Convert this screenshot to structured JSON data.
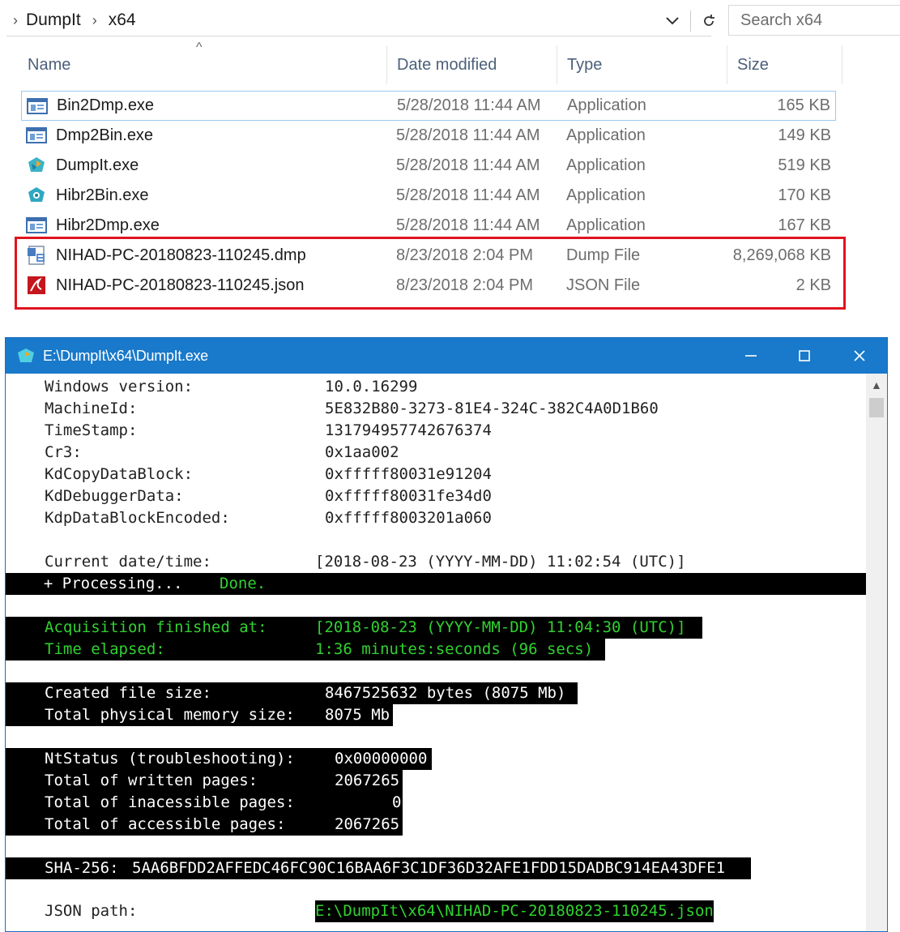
{
  "explorer": {
    "breadcrumb": [
      "DumpIt",
      "x64"
    ],
    "search_placeholder": "Search x64",
    "columns": {
      "name": "Name",
      "date": "Date modified",
      "type": "Type",
      "size": "Size"
    },
    "files": [
      {
        "name": "Bin2Dmp.exe",
        "date": "5/28/2018 11:44 AM",
        "type": "Application",
        "size": "165 KB",
        "icon": "exe-window-icon"
      },
      {
        "name": "Dmp2Bin.exe",
        "date": "5/28/2018 11:44 AM",
        "type": "Application",
        "size": "149 KB",
        "icon": "exe-window-icon"
      },
      {
        "name": "DumpIt.exe",
        "date": "5/28/2018 11:44 AM",
        "type": "Application",
        "size": "519 KB",
        "icon": "dumpit-icon"
      },
      {
        "name": "Hibr2Bin.exe",
        "date": "5/28/2018 11:44 AM",
        "type": "Application",
        "size": "170 KB",
        "icon": "hibr-icon"
      },
      {
        "name": "Hibr2Dmp.exe",
        "date": "5/28/2018 11:44 AM",
        "type": "Application",
        "size": "167 KB",
        "icon": "exe-window-icon"
      },
      {
        "name": "NIHAD-PC-20180823-110245.dmp",
        "date": "8/23/2018 2:04 PM",
        "type": "Dump File",
        "size": "8,269,068 KB",
        "icon": "dump-file-icon"
      },
      {
        "name": "NIHAD-PC-20180823-110245.json",
        "date": "8/23/2018 2:04 PM",
        "type": "JSON File",
        "size": "2 KB",
        "icon": "json-file-icon"
      }
    ]
  },
  "console": {
    "title": "E:\\DumpIt\\x64\\DumpIt.exe",
    "info": [
      {
        "k": "Windows version:",
        "v": "10.0.16299"
      },
      {
        "k": "MachineId:",
        "v": "5E832B80-3273-81E4-324C-382C4A0D1B60"
      },
      {
        "k": "TimeStamp:",
        "v": "131794957742676374"
      },
      {
        "k": "Cr3:",
        "v": "0x1aa002"
      },
      {
        "k": "KdCopyDataBlock:",
        "v": "0xfffff80031e91204"
      },
      {
        "k": "KdDebuggerData:",
        "v": "0xfffff80031fe34d0"
      },
      {
        "k": "KdpDataBlockEncoded:",
        "v": "0xfffff8003201a060"
      }
    ],
    "current_label": "Current date/time:",
    "current_value": "[2018-08-23 (YYYY-MM-DD) 11:02:54 (UTC)]",
    "processing": "  + Processing... ",
    "done": "Done.",
    "acq_label": "Acquisition finished at:",
    "acq_value": "[2018-08-23 (YYYY-MM-DD) 11:04:30 (UTC)]",
    "elapsed_label": "Time elapsed:",
    "elapsed_value": "1:36 minutes:seconds (96 secs)",
    "created_label": "Created file size:",
    "created_value": "8467525632 bytes (8075 Mb)",
    "phys_label": "Total physical memory size:",
    "phys_value": "8075 Mb",
    "nt_label": "NtStatus (troubleshooting):",
    "nt_value": "0x00000000",
    "written_label": "Total of written pages:",
    "written_value": "2067265",
    "inacc_label": "Total of inacessible pages:",
    "inacc_value": "0",
    "acc_label": "Total of accessible pages:",
    "acc_value": "2067265",
    "sha_label": "SHA-256:",
    "sha_value": "5AA6BFDD2AFFEDC46FC90C16BAA6F3C1DF36D32AFE1FDD15DADBC914EA43DFE1",
    "json_label": "JSON path:",
    "json_value": "E:\\DumpIt\\x64\\NIHAD-PC-20180823-110245.json"
  },
  "colors": {
    "title_bar": "#1979ca",
    "highlight": "#e0141e",
    "terminal_green": "#31d131"
  }
}
